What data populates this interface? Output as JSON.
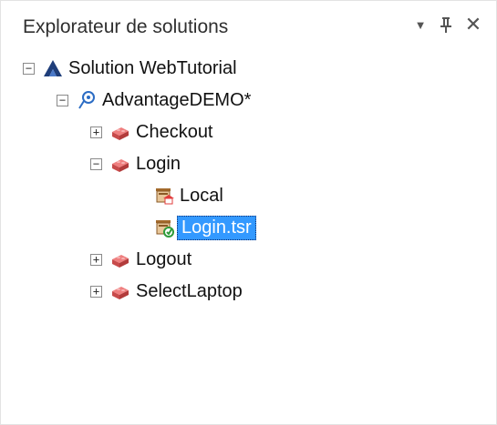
{
  "panel": {
    "title": "Explorateur de solutions",
    "controls": {
      "dropdown_icon": "dropdown-arrow-icon",
      "pin_icon": "pin-icon",
      "close_icon": "close-icon",
      "dropdown_glyph": "▼",
      "close_glyph": "✕"
    }
  },
  "tree": {
    "solution": {
      "label": "Solution WebTutorial",
      "expander": "−",
      "icon": "solution-icon"
    },
    "project": {
      "label": "AdvantageDEMO*",
      "expander": "−",
      "icon": "project-icon"
    },
    "items": [
      {
        "label": "Checkout",
        "expander": "+",
        "icon": "action-icon"
      },
      {
        "label": "Login",
        "expander": "−",
        "icon": "action-icon"
      },
      {
        "label": "Local",
        "icon": "local-object-repository-icon"
      },
      {
        "label": "Login.tsr",
        "icon": "shared-object-repository-icon",
        "selected": true
      },
      {
        "label": "Logout",
        "expander": "+",
        "icon": "action-icon"
      },
      {
        "label": "SelectLaptop",
        "expander": "+",
        "icon": "action-icon"
      }
    ]
  },
  "colors": {
    "selection": "#3399ff",
    "action_icon": "#d9534f",
    "solution_icon": "#1f3e7a"
  }
}
